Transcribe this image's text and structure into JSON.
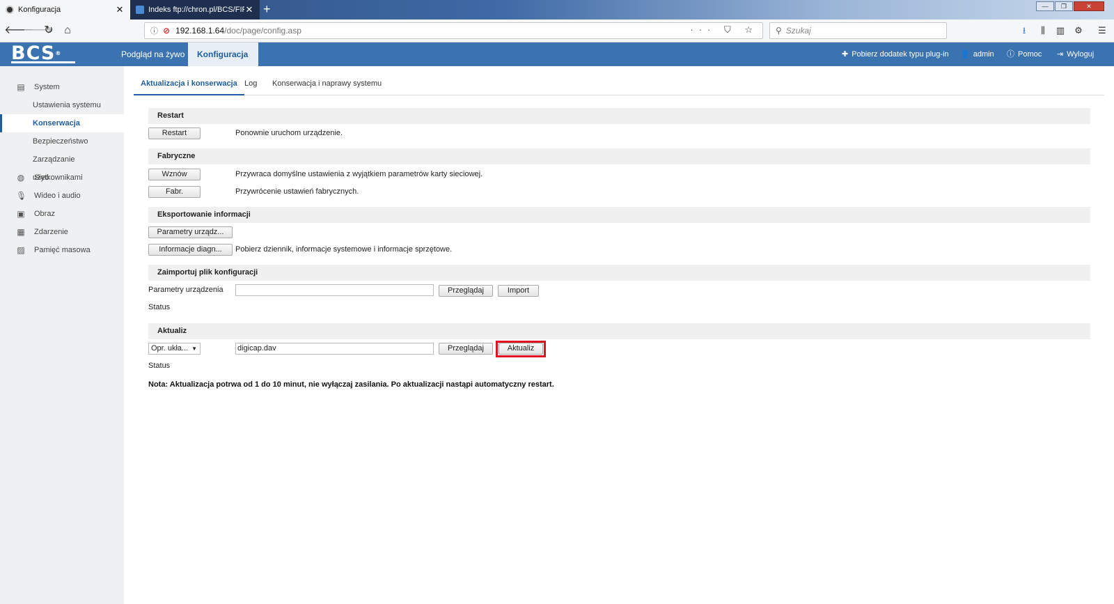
{
  "browser": {
    "tabs": [
      {
        "label": "Konfiguracja",
        "active": true
      },
      {
        "label": "Indeks ftp://chron.pl/BCS/FIRM",
        "active": false
      }
    ],
    "new_tab": "+",
    "url_host": "192.168.1.64",
    "url_path": "/doc/page/config.asp",
    "url_actions": "··· ⛉ ☆",
    "search_placeholder": "Szukaj",
    "window_controls": {
      "minimize": "—",
      "maximize": "❐",
      "close": "✕"
    }
  },
  "header": {
    "logo": "BCS",
    "logo_mark": "®",
    "menu": [
      {
        "label": "Podgląd na żywo",
        "active": false
      },
      {
        "label": "Konfiguracja",
        "active": true
      }
    ],
    "right": [
      {
        "label": "Pobierz dodatek typu plug-in",
        "icon": "puzzle-icon"
      },
      {
        "label": "admin",
        "icon": "user-icon"
      },
      {
        "label": "Pomoc",
        "icon": "help-icon"
      },
      {
        "label": "Wyloguj",
        "icon": "logout-icon"
      }
    ]
  },
  "sidebar": {
    "system": {
      "label": "System",
      "icon": "system-icon"
    },
    "system_sub": [
      {
        "label": "Ustawienia systemu",
        "active": false
      },
      {
        "label": "Konserwacja",
        "active": true
      },
      {
        "label": "Bezpieczeństwo",
        "active": false
      },
      {
        "label": "Zarządzanie użytkownikami",
        "active": false
      }
    ],
    "items": [
      {
        "label": "Sieć",
        "icon": "network-icon"
      },
      {
        "label": "Wideo i audio",
        "icon": "microphone-icon"
      },
      {
        "label": "Obraz",
        "icon": "image-icon"
      },
      {
        "label": "Zdarzenie",
        "icon": "calendar-icon"
      },
      {
        "label": "Pamięć masowa",
        "icon": "storage-icon"
      }
    ]
  },
  "subtabs": [
    {
      "label": "Aktualizacja i konserwacja",
      "active": true
    },
    {
      "label": "Log",
      "active": false
    },
    {
      "label": "Konserwacja i naprawy systemu",
      "active": false
    }
  ],
  "sections": {
    "restart": {
      "title": "Restart",
      "button": "Restart",
      "desc": "Ponownie uruchom urządzenie."
    },
    "factory": {
      "title": "Fabryczne",
      "restore_button": "Wznów",
      "restore_desc": "Przywraca domyślne ustawienia z wyjątkiem parametrów karty sieciowej.",
      "default_button": "Fabr.",
      "default_desc": "Przywrócenie ustawień fabrycznych."
    },
    "export": {
      "title": "Eksportowanie informacji",
      "params_button": "Parametry urządz...",
      "diag_button": "Informacje diagn...",
      "diag_desc": "Pobierz dziennik, informacje systemowe i informacje sprzętowe."
    },
    "import": {
      "title": "Zaimportuj plik konfiguracji",
      "field_label": "Parametry urządzenia",
      "field_value": "",
      "browse_button": "Przeglądaj",
      "import_button": "Import",
      "status_label": "Status"
    },
    "upgrade": {
      "title": "Aktualiz",
      "select_value": "Opr. ukła...",
      "field_value": "digicap.dav",
      "browse_button": "Przeglądaj",
      "upgrade_button": "Aktualiz",
      "status_label": "Status"
    }
  },
  "note": "Nota: Aktualizacja potrwa od 1 do 10 minut, nie wyłączaj zasilania. Po aktualizacji nastąpi automatyczny restart.",
  "colors": {
    "header_blue": "#3b73b1",
    "active_blue": "#1f5e9e",
    "highlight_red": "#e0141e"
  }
}
